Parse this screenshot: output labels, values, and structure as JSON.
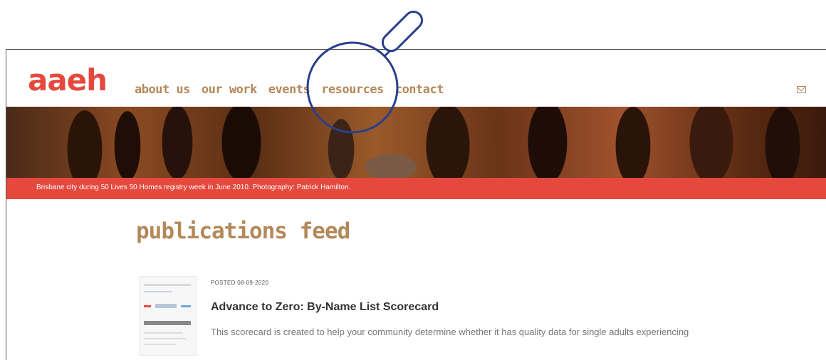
{
  "site": {
    "logo_text": "aaeh",
    "brand_color": "#e5483d",
    "nav_color": "#b3895a"
  },
  "nav": {
    "items": [
      "about us",
      "our work",
      "events",
      "resources",
      "contact"
    ]
  },
  "header_icons": [
    "mail-icon"
  ],
  "banner": {
    "caption": "Brisbane city during 50 Lives 50 Homes registry week in June 2010. Photography: Patrick Hamilton."
  },
  "main": {
    "title": "publications feed",
    "article": {
      "posted": "POSTED 08-09-2020",
      "title": "Advance to Zero: By-Name List Scorecard",
      "excerpt": "This scorecard is created to help your community determine whether it has quality data for single adults experiencing"
    }
  },
  "overlay": {
    "icon": "magnifier-icon",
    "color": "#2a3f8a"
  }
}
